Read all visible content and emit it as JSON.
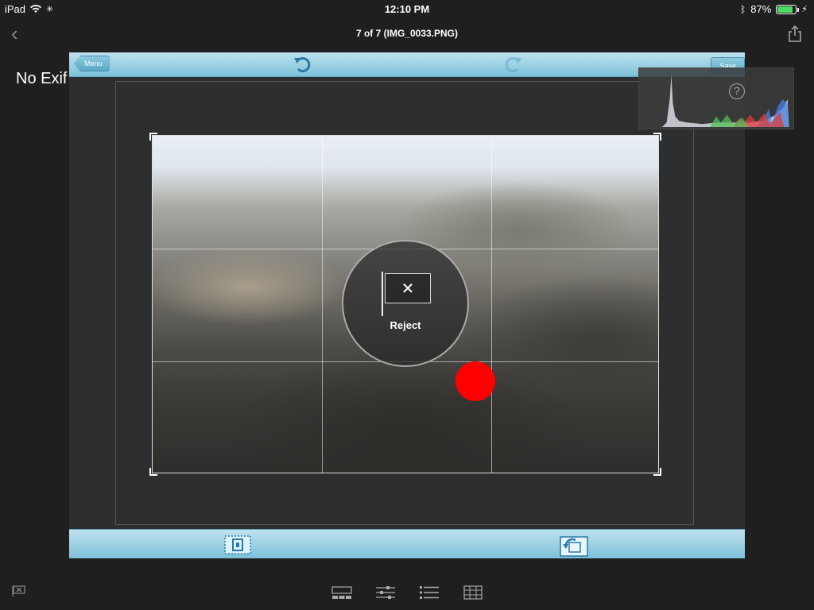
{
  "status_bar": {
    "device": "iPad",
    "time": "12:10 PM",
    "battery": "87%",
    "battery_level": 0.87
  },
  "nav": {
    "title": "7 of 7 (IMG_0033.PNG)"
  },
  "editor": {
    "menu_label": "Menu",
    "save_label": "Save",
    "reject_label": "Reject",
    "reject_glyph": "✕"
  },
  "info": {
    "exif_text": "No Exif Information",
    "help_glyph": "?"
  },
  "colors": {
    "toolbar_accent": "#7cc1d9",
    "battery_green": "#4cd964",
    "marker_red": "#ff0000"
  }
}
